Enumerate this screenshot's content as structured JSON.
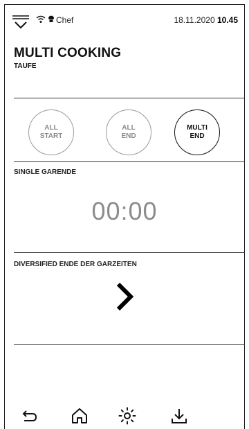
{
  "status_bar": {
    "user": "Chef",
    "date": "18.11.2020",
    "time": "10.45"
  },
  "header": {
    "title": "MULTI COOKING",
    "subtitle": "TAUFE"
  },
  "modes": [
    {
      "line1": "ALL",
      "line2": "START",
      "active": false
    },
    {
      "line1": "ALL",
      "line2": "END",
      "active": false
    },
    {
      "line1": "MULTI",
      "line2": "END",
      "active": true
    }
  ],
  "single": {
    "label": "SINGLE GARENDE",
    "timer": "00:00"
  },
  "diversified": {
    "label": "DIVERSIFIED ENDE DER GARZEITEN"
  },
  "icons": {
    "menu": "menu-chevron-icon",
    "wifi": "wifi-icon",
    "chef": "chef-hat-icon",
    "forward": "chevron-right-icon",
    "back": "back-arrow-icon",
    "home": "home-icon",
    "brightness": "brightness-icon",
    "download": "download-icon"
  }
}
